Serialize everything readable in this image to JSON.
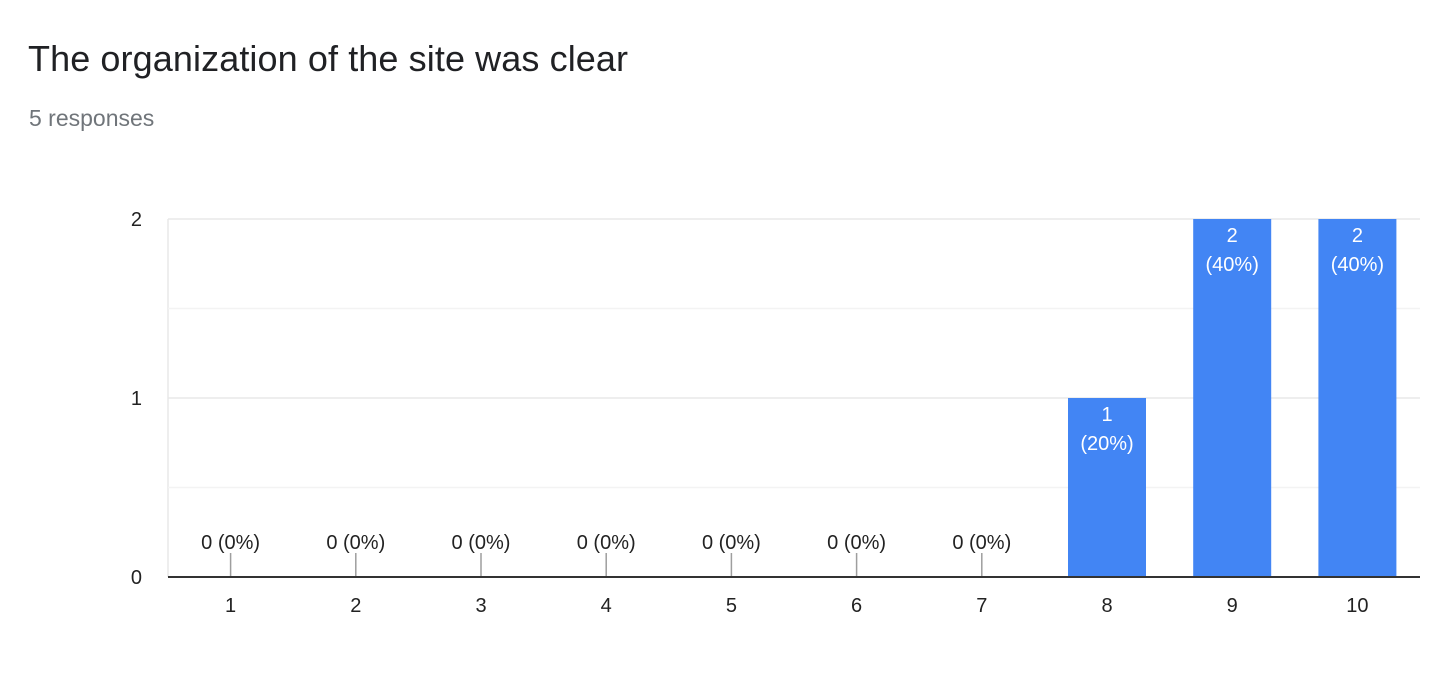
{
  "question": {
    "title": "The organization of the site was clear",
    "responses_text": "5 responses"
  },
  "colors": {
    "bar": "#4285f4",
    "gridline": "#e8e8e8",
    "minor_gridline": "#f3f3f3",
    "axis": "#333333",
    "zero_tick": "#9e9e9e"
  },
  "chart_data": {
    "type": "bar",
    "title": "The organization of the site was clear",
    "subtitle": "5 responses",
    "xlabel": "",
    "ylabel": "",
    "categories": [
      "1",
      "2",
      "3",
      "4",
      "5",
      "6",
      "7",
      "8",
      "9",
      "10"
    ],
    "values": [
      0,
      0,
      0,
      0,
      0,
      0,
      0,
      1,
      2,
      2
    ],
    "labels": [
      "0 (0%)",
      "0 (0%)",
      "0 (0%)",
      "0 (0%)",
      "0 (0%)",
      "0 (0%)",
      "0 (0%)",
      "1 (20%)",
      "2 (40%)",
      "2 (40%)"
    ],
    "ylim": [
      0,
      2
    ],
    "yticks": [
      "0",
      "1",
      "2"
    ],
    "grid": true,
    "legend": "none"
  }
}
